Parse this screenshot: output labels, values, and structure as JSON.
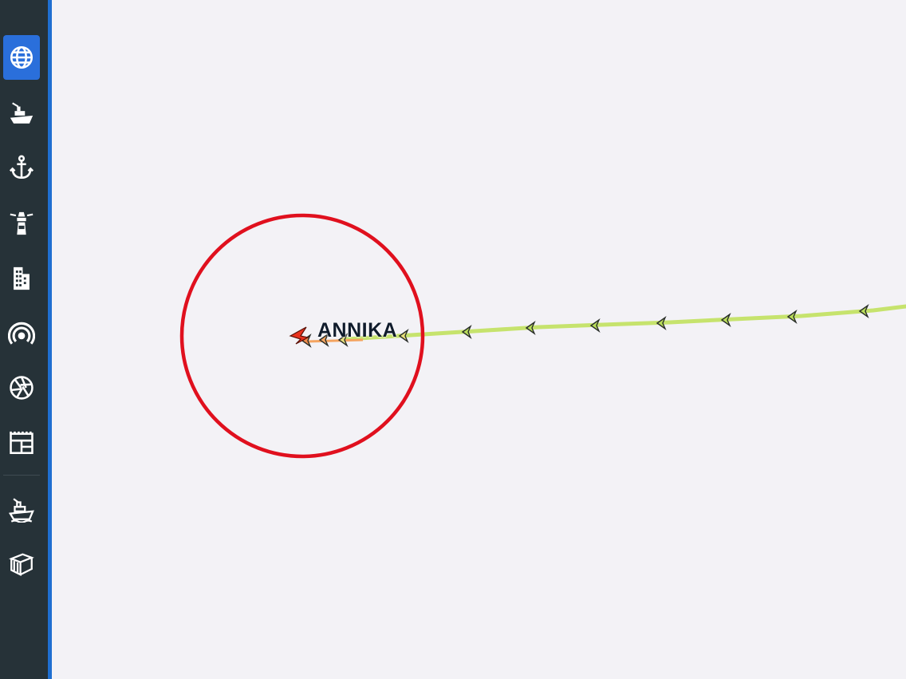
{
  "sidebar": {
    "items": [
      {
        "icon": "globe-icon",
        "active": true
      },
      {
        "icon": "ship-icon",
        "active": false
      },
      {
        "icon": "anchor-icon",
        "active": false
      },
      {
        "icon": "lighthouse-icon",
        "active": false
      },
      {
        "icon": "building-icon",
        "active": false
      },
      {
        "icon": "broadcast-icon",
        "active": false
      },
      {
        "icon": "aperture-icon",
        "active": false
      },
      {
        "icon": "port-icon",
        "active": false
      },
      {
        "icon": "ship-fleet-icon",
        "active": false
      },
      {
        "icon": "container-icon",
        "active": false
      }
    ],
    "background": "#263238",
    "accent": "#2a6fdb"
  },
  "map": {
    "background": "#f3f2f6",
    "vessel": {
      "name": "ANNIKA",
      "marker_color": "#e8321e"
    },
    "track": {
      "color": "#c6e36d",
      "recent_color": "#f4a460"
    },
    "highlight_circle": {
      "color": "#e0101e"
    }
  }
}
